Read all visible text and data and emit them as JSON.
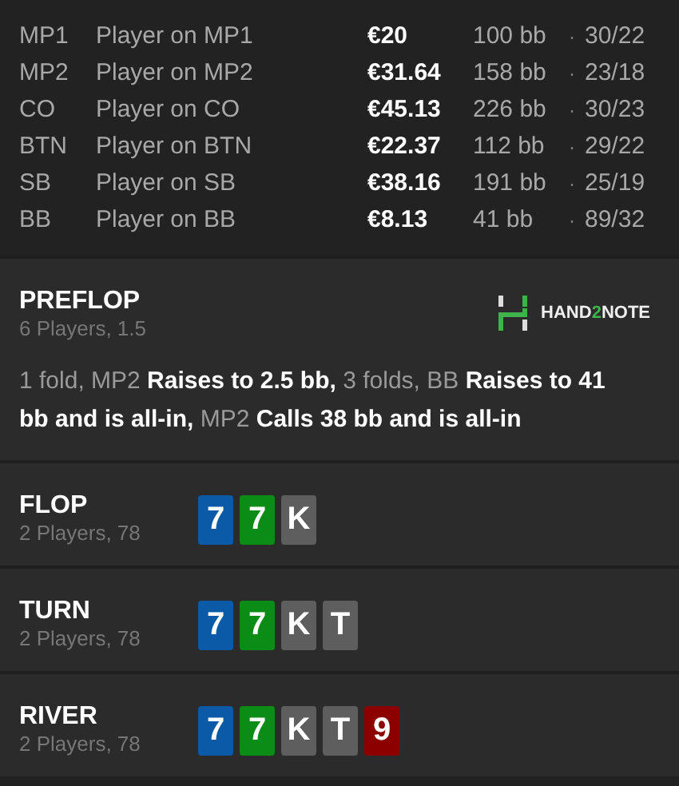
{
  "players": [
    {
      "position": "MP1",
      "name": "Player on MP1",
      "stack": "€20",
      "bb": "100 bb",
      "separator": "·",
      "stats": "30/22"
    },
    {
      "position": "MP2",
      "name": "Player on MP2",
      "stack": "€31.64",
      "bb": "158 bb",
      "separator": "·",
      "stats": "23/18"
    },
    {
      "position": "CO",
      "name": "Player on CO",
      "stack": "€45.13",
      "bb": "226 bb",
      "separator": "·",
      "stats": "30/23"
    },
    {
      "position": "BTN",
      "name": "Player on BTN",
      "stack": "€22.37",
      "bb": "112 bb",
      "separator": "·",
      "stats": "29/22"
    },
    {
      "position": "SB",
      "name": "Player on SB",
      "stack": "€38.16",
      "bb": "191 bb",
      "separator": "·",
      "stats": "25/19"
    },
    {
      "position": "BB",
      "name": "Player on BB",
      "stack": "€8.13",
      "bb": "41 bb",
      "separator": "·",
      "stats": "89/32"
    }
  ],
  "streets": [
    {
      "title": "PREFLOP",
      "subtitle": "6 Players, 1.5",
      "logo": [
        {
          "text": "HAND",
          "accent": false
        },
        {
          "text": "2",
          "accent": true
        },
        {
          "text": "NOTE",
          "accent": false
        }
      ],
      "actions": [
        {
          "kind": "muted",
          "text": "1 fold, MP2 "
        },
        {
          "kind": "action",
          "text": "Raises to 2.5 bb, "
        },
        {
          "kind": "muted",
          "text": "3 folds, BB "
        },
        {
          "kind": "action",
          "text": "Raises to 41 bb and is all-in, "
        },
        {
          "kind": "muted",
          "text": "MP2 "
        },
        {
          "kind": "action",
          "text": "Calls 38 bb and is all-in"
        }
      ]
    },
    {
      "title": "FLOP",
      "subtitle": "2 Players, 78",
      "cards": [
        {
          "rank": "7",
          "color": "#0b5aa8"
        },
        {
          "rank": "7",
          "color": "#0a8c17"
        },
        {
          "rank": "K",
          "color": "#5e5e5e"
        }
      ]
    },
    {
      "title": "TURN",
      "subtitle": "2 Players, 78",
      "cards": [
        {
          "rank": "7",
          "color": "#0b5aa8"
        },
        {
          "rank": "7",
          "color": "#0a8c17"
        },
        {
          "rank": "K",
          "color": "#5e5e5e"
        },
        {
          "rank": "T",
          "color": "#5e5e5e"
        }
      ]
    },
    {
      "title": "RIVER",
      "subtitle": "2 Players, 78",
      "cards": [
        {
          "rank": "7",
          "color": "#0b5aa8"
        },
        {
          "rank": "7",
          "color": "#0a8c17"
        },
        {
          "rank": "K",
          "color": "#5e5e5e"
        },
        {
          "rank": "T",
          "color": "#5e5e5e"
        },
        {
          "rank": "9",
          "color": "#8c0000"
        }
      ]
    }
  ]
}
